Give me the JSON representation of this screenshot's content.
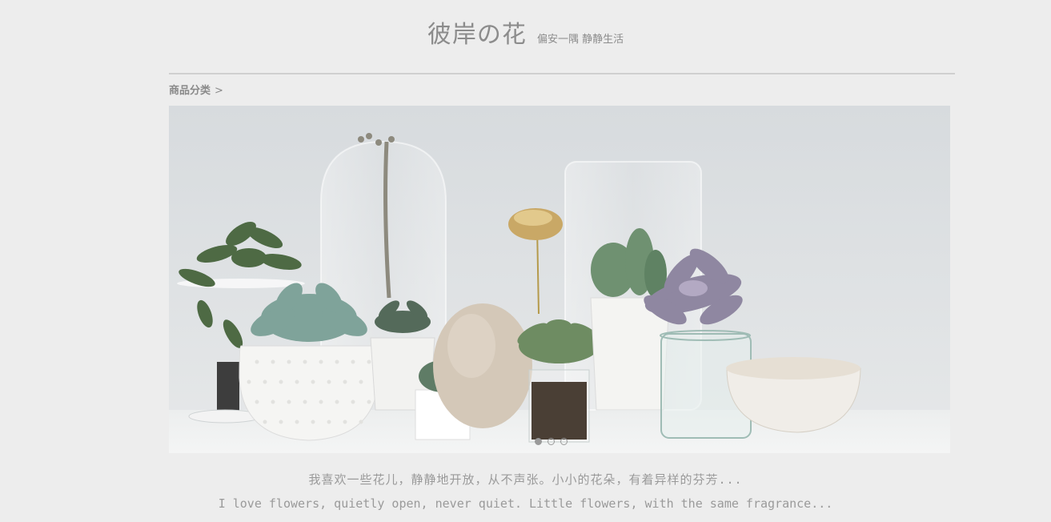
{
  "header": {
    "title": "彼岸の花",
    "subtitle": "偏安一隅 静静生活"
  },
  "nav": {
    "breadcrumb_label": "商品分类",
    "breadcrumb_arrow": ">"
  },
  "banner": {
    "image_subject": "succulent plants in white pots and glass jars",
    "slides": 3,
    "active_slide": 1
  },
  "captions": {
    "chinese": "我喜欢一些花儿，静静地开放，从不声张。小小的花朵，有着异样的芬芳...",
    "english": "I love flowers, quietly open, never quiet. Little flowers, with the same fragrance..."
  },
  "colors": {
    "background": "#ededed",
    "text_gray": "#8c8c8c",
    "divider": "#cfcfcf"
  }
}
